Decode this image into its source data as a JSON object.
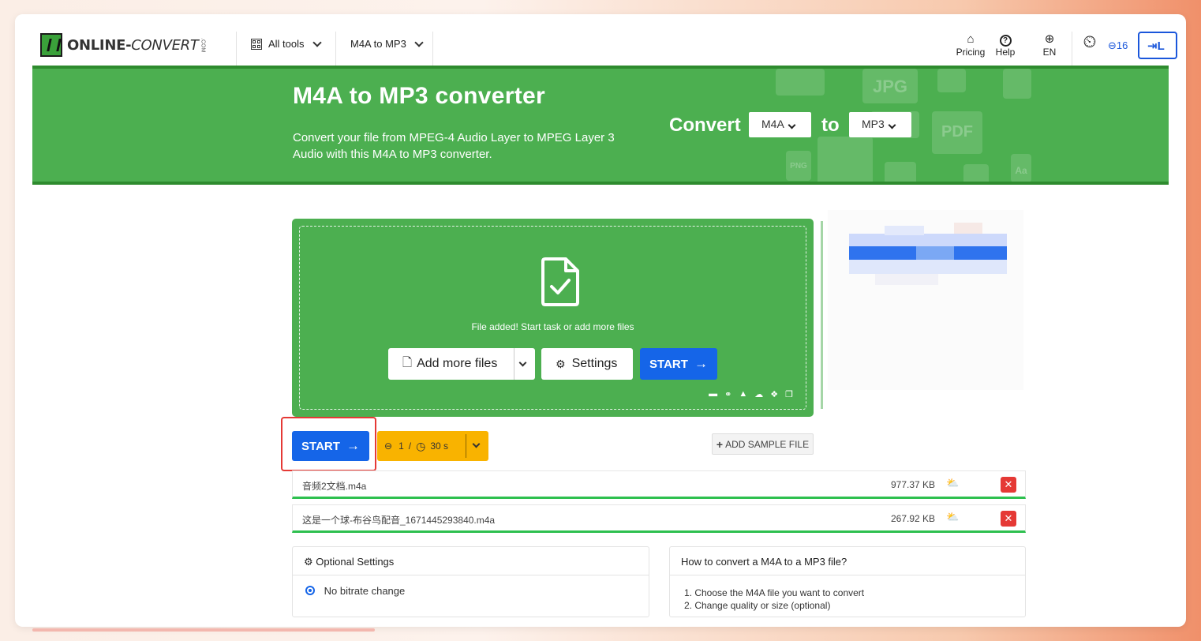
{
  "header": {
    "brand_main": "ONLINE-",
    "brand_accent": "CONVERT",
    "brand_suffix": ".COM",
    "all_tools": "All tools",
    "m4a_to_mp3": "M4A to MP3",
    "pricing": "Pricing",
    "help": "Help",
    "language": "EN",
    "credits_count": "16",
    "login": "L"
  },
  "banner": {
    "title": "M4A to MP3 converter",
    "description": "Convert your file from MPEG-4 Audio Layer to MPEG Layer 3 Audio with this M4A to MP3 converter.",
    "convert_label": "Convert",
    "from_format": "M4A",
    "to_label": "to",
    "to_format": "MP3",
    "bg_icons": [
      "JPG",
      "PDF",
      "PNG",
      "Aa"
    ]
  },
  "upload": {
    "message": "File added! Start task or add more files",
    "add_more_files": "Add more files",
    "settings": "Settings",
    "start": "START"
  },
  "actions": {
    "start": "START",
    "credits": "1",
    "credits_sep": "/",
    "time": "30 s",
    "add_sample_file": "ADD SAMPLE FILE"
  },
  "files": [
    {
      "name": "音频2文档.m4a",
      "size": "977.37 KB"
    },
    {
      "name": "这是一个球-布谷鸟配音_1671445293840.m4a",
      "size": "267.92 KB"
    }
  ],
  "optional_settings": {
    "title": "Optional Settings",
    "option": "No bitrate change"
  },
  "howto": {
    "title": "How to convert a M4A to a MP3 file?",
    "steps": [
      "1. Choose the M4A file you want to convert",
      "2. Change quality or size (optional)"
    ]
  },
  "colors": {
    "brand_green": "#4caf50",
    "primary_blue": "#1565e8",
    "credit_yellow": "#f9b300",
    "danger_red": "#e53935"
  }
}
